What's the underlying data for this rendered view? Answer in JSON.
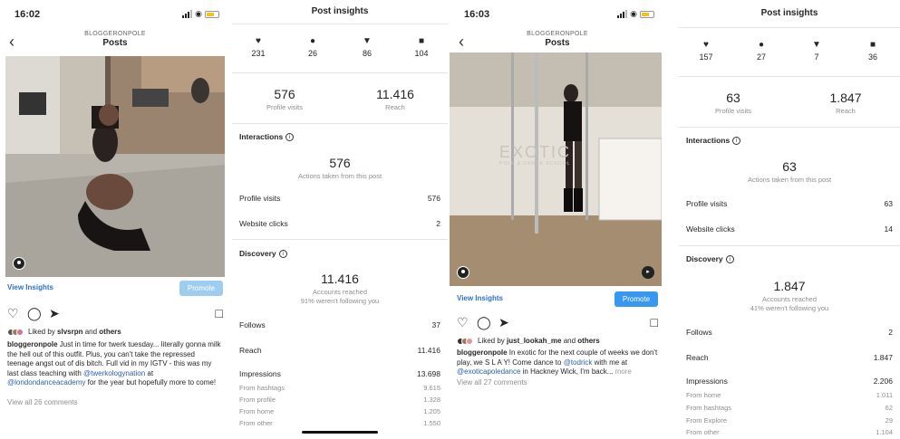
{
  "post1": {
    "time": "16:02",
    "username": "BLOGGERONPOLE",
    "title": "Posts",
    "view_insights": "View Insights",
    "promote": "Promote",
    "liked_by": "Liked by ",
    "liked_user": "slvsrpn",
    "liked_and": " and ",
    "liked_others": "others",
    "caption_user": "bloggeronpole",
    "caption_1": " Just in time for twerk tuesday... literally gonna milk the hell out of this outfit. Plus, you can't take the repressed teenage angst out of dis bitch. Full vid in my IGTV - this was my last class teaching with ",
    "caption_tag1": "@twerkologynation",
    "caption_2": " at ",
    "caption_tag2": "@londondanceacademy",
    "caption_3": " for the year but hopefully more to come!",
    "comments": "View all 26 comments"
  },
  "insights1": {
    "title": "Post insights",
    "likes": "231",
    "comments": "26",
    "shares": "86",
    "saves": "104",
    "profile_visits_num": "576",
    "profile_visits_label": "Profile visits",
    "reach_num": "11.416",
    "reach_label": "Reach",
    "interactions_label": "Interactions",
    "actions_num": "576",
    "actions_label": "Actions taken from this post",
    "profile_visits_row": "Profile visits",
    "profile_visits_val": "576",
    "website_clicks_row": "Website clicks",
    "website_clicks_val": "2",
    "discovery_label": "Discovery",
    "accounts_num": "11.416",
    "accounts_label": "Accounts reached",
    "accounts_sub": "91% weren't following you",
    "follows_row": "Follows",
    "follows_val": "37",
    "reach_row": "Reach",
    "reach_val": "11.416",
    "impressions_row": "Impressions",
    "impressions_val": "13.698",
    "from": [
      {
        "label": "From hashtags",
        "value": "9.615"
      },
      {
        "label": "From profile",
        "value": "1.328"
      },
      {
        "label": "From home",
        "value": "1.205"
      },
      {
        "label": "From other",
        "value": "1.550"
      }
    ]
  },
  "post2": {
    "time": "16:03",
    "username": "BLOGGERONPOLE",
    "title": "Posts",
    "view_insights": "View Insights",
    "promote": "Promote",
    "liked_by": "Liked by ",
    "liked_user": "just_lookah_me",
    "liked_and": " and ",
    "liked_others": "others",
    "caption_user": "bloggeronpole",
    "caption_1": " In exotic for the next couple of weeks we don't play, we S L A Y! Come dance to ",
    "caption_tag1": "@todrick",
    "caption_2": " with me at ",
    "caption_tag2": "@exoticapoledance",
    "caption_3": " in Hackney Wick, I'm back... ",
    "caption_more": "more",
    "comments": "View all 27 comments",
    "wall_text": "EXOTIC",
    "wall_sub": "POLE & DANCE SCHOOL"
  },
  "insights2": {
    "title": "Post insights",
    "likes": "157",
    "comments": "27",
    "shares": "7",
    "saves": "36",
    "profile_visits_num": "63",
    "profile_visits_label": "Profile visits",
    "reach_num": "1.847",
    "reach_label": "Reach",
    "interactions_label": "Interactions",
    "actions_num": "63",
    "actions_label": "Actions taken from this post",
    "profile_visits_row": "Profile visits",
    "profile_visits_val": "63",
    "website_clicks_row": "Website clicks",
    "website_clicks_val": "14",
    "discovery_label": "Discovery",
    "accounts_num": "1.847",
    "accounts_label": "Accounts reached",
    "accounts_sub": "41% weren't following you",
    "follows_row": "Follows",
    "follows_val": "2",
    "reach_row": "Reach",
    "reach_val": "1.847",
    "impressions_row": "Impressions",
    "impressions_val": "2.206",
    "from": [
      {
        "label": "From home",
        "value": "1.011"
      },
      {
        "label": "From hashtags",
        "value": "62"
      },
      {
        "label": "From Explore",
        "value": "29"
      },
      {
        "label": "From other",
        "value": "1.104"
      }
    ]
  },
  "colors": {
    "promote_light": "#9fcdf0",
    "promote_active": "#3897f0",
    "link": "#2a72c8"
  }
}
